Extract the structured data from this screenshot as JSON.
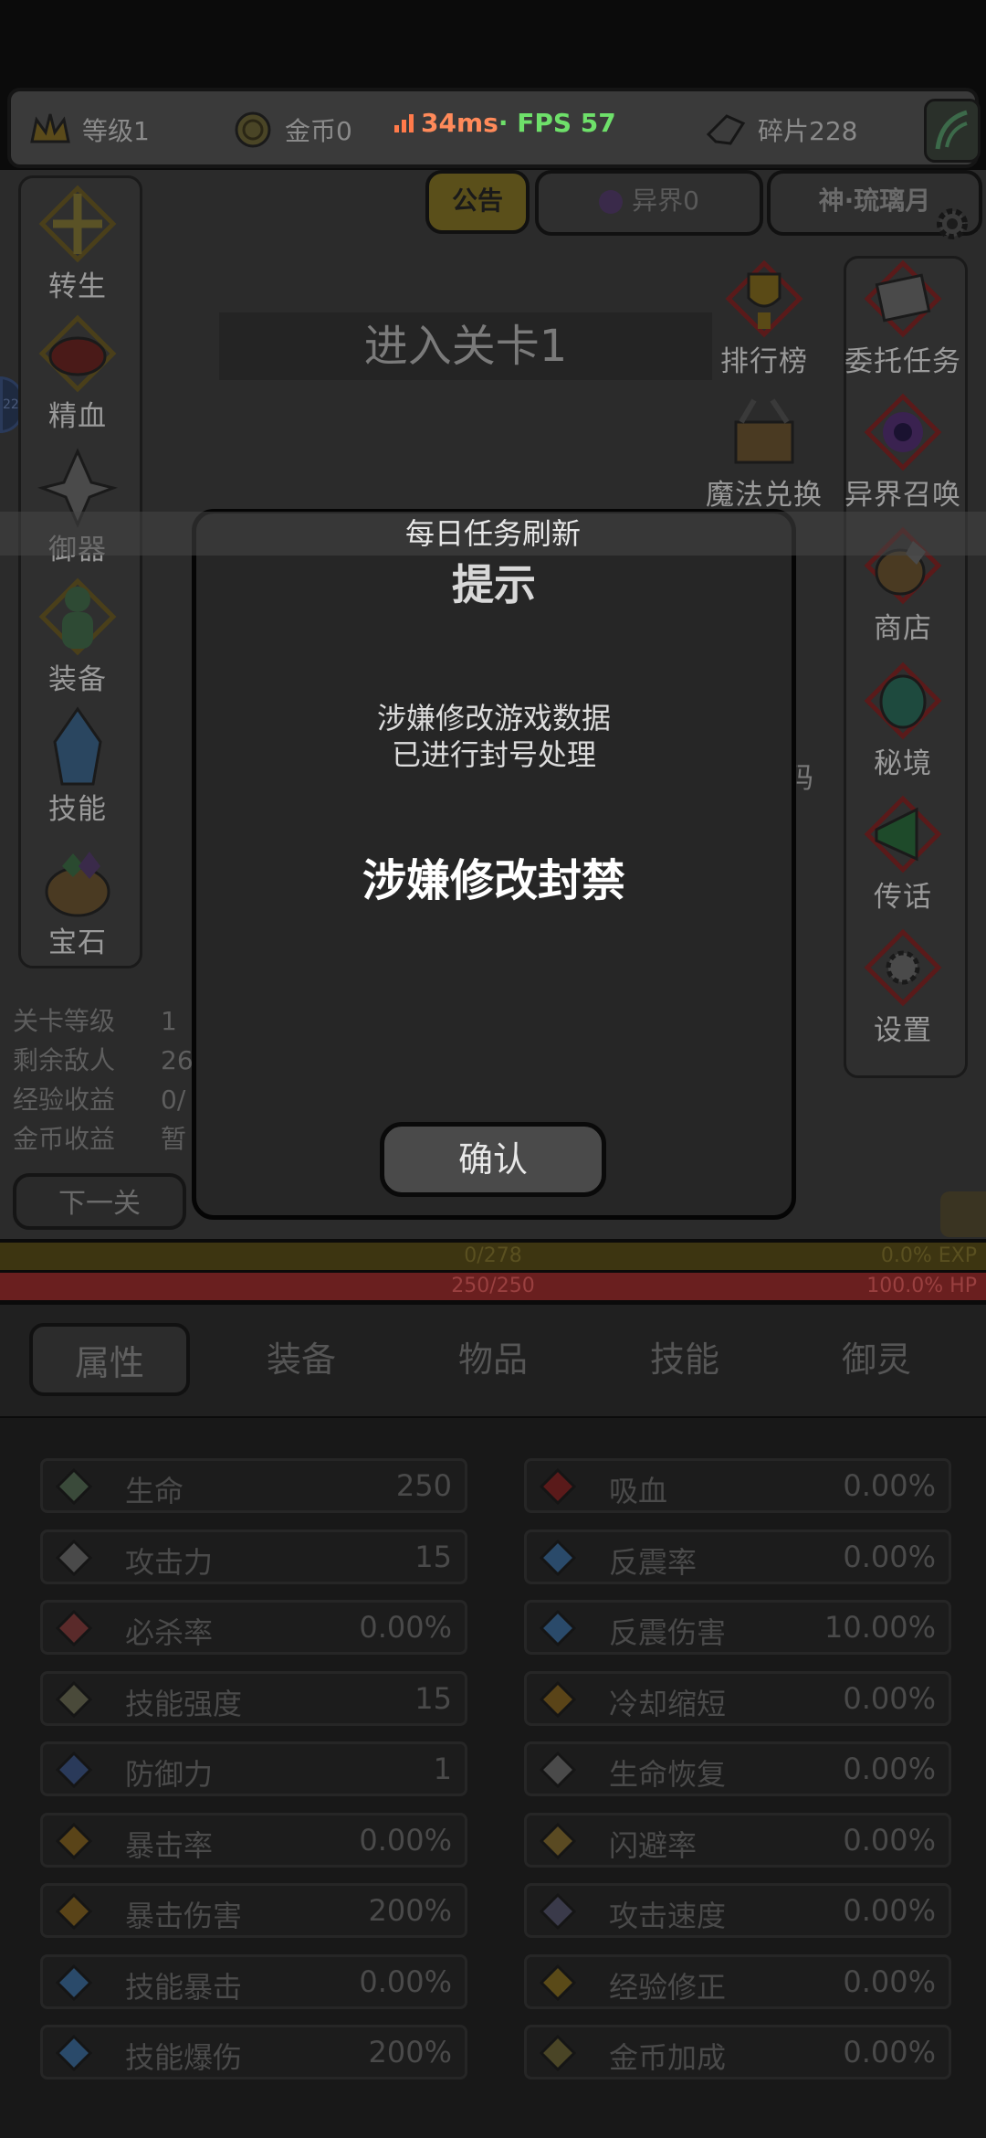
{
  "topbar": {
    "level": "等级1",
    "gold": "金币0",
    "ping_ms": "34ms",
    "fps": "· FPS 57",
    "shards": "碎片228"
  },
  "scene_tabs": {
    "notice": "公告",
    "otherworld": "异界0",
    "player_name": "神·琉璃月"
  },
  "stage_title": "进入关卡1",
  "left_menu": [
    "转生",
    "精血",
    "御器",
    "装备",
    "技能",
    "宝石"
  ],
  "right_menu_a": [
    "排行榜",
    "魔法兑换",
    "码"
  ],
  "right_menu_b": [
    "委托任务",
    "异界召唤",
    "商店",
    "秘境",
    "传话",
    "设置"
  ],
  "side_badge": "22",
  "stage_stats": [
    {
      "label": "关卡等级",
      "value": "1"
    },
    {
      "label": "剩余敌人",
      "value": "26"
    },
    {
      "label": "经验收益",
      "value": "0/"
    },
    {
      "label": "金币收益",
      "value": "暂"
    }
  ],
  "next_button": "下一关",
  "exp": {
    "value": "0/278",
    "pct": "0.0% EXP"
  },
  "hp": {
    "value": "250/250",
    "pct": "100.0%  HP"
  },
  "bottom_tabs": [
    "属性",
    "装备",
    "物品",
    "技能",
    "御灵"
  ],
  "attributes_left": [
    {
      "name": "生命",
      "value": "250",
      "icon": "cross-sword-icon"
    },
    {
      "name": "攻击力",
      "value": "15",
      "icon": "sword-icon"
    },
    {
      "name": "必杀率",
      "value": "0.00%",
      "icon": "slash-icon"
    },
    {
      "name": "技能强度",
      "value": "15",
      "icon": "lightning-icon"
    },
    {
      "name": "防御力",
      "value": "1",
      "icon": "shield-icon"
    },
    {
      "name": "暴击率",
      "value": "0.00%",
      "icon": "flame-icon"
    },
    {
      "name": "暴击伤害",
      "value": "200%",
      "icon": "flame-icon"
    },
    {
      "name": "技能暴击",
      "value": "0.00%",
      "icon": "blue-flame-icon"
    },
    {
      "name": "技能爆伤",
      "value": "200%",
      "icon": "blue-flame-icon"
    }
  ],
  "attributes_right": [
    {
      "name": "吸血",
      "value": "0.00%",
      "icon": "bat-icon"
    },
    {
      "name": "反震率",
      "value": "0.00%",
      "icon": "ice-burst-icon"
    },
    {
      "name": "反震伤害",
      "value": "10.00%",
      "icon": "ice-burst-icon"
    },
    {
      "name": "冷却缩短",
      "value": "0.00%",
      "icon": "cooldown-icon"
    },
    {
      "name": "生命恢复",
      "value": "0.00%",
      "icon": "heal-icon"
    },
    {
      "name": "闪避率",
      "value": "0.00%",
      "icon": "boot-icon"
    },
    {
      "name": "攻击速度",
      "value": "0.00%",
      "icon": "swords-icon"
    },
    {
      "name": "经验修正",
      "value": "0.00%",
      "icon": "crown-icon"
    },
    {
      "name": "金币加成",
      "value": "0.00%",
      "icon": "coin-icon"
    }
  ],
  "modal": {
    "banner": "每日任务刷新",
    "title": "提示",
    "line1": "涉嫌修改游戏数据",
    "line2": "已进行封号处理",
    "headline": "涉嫌修改封禁",
    "confirm": "确认"
  },
  "colors": {
    "ping": "#ff8a5a",
    "fps": "#6ee06a",
    "hp": "#6a1f1f",
    "exp": "#3d3511"
  }
}
